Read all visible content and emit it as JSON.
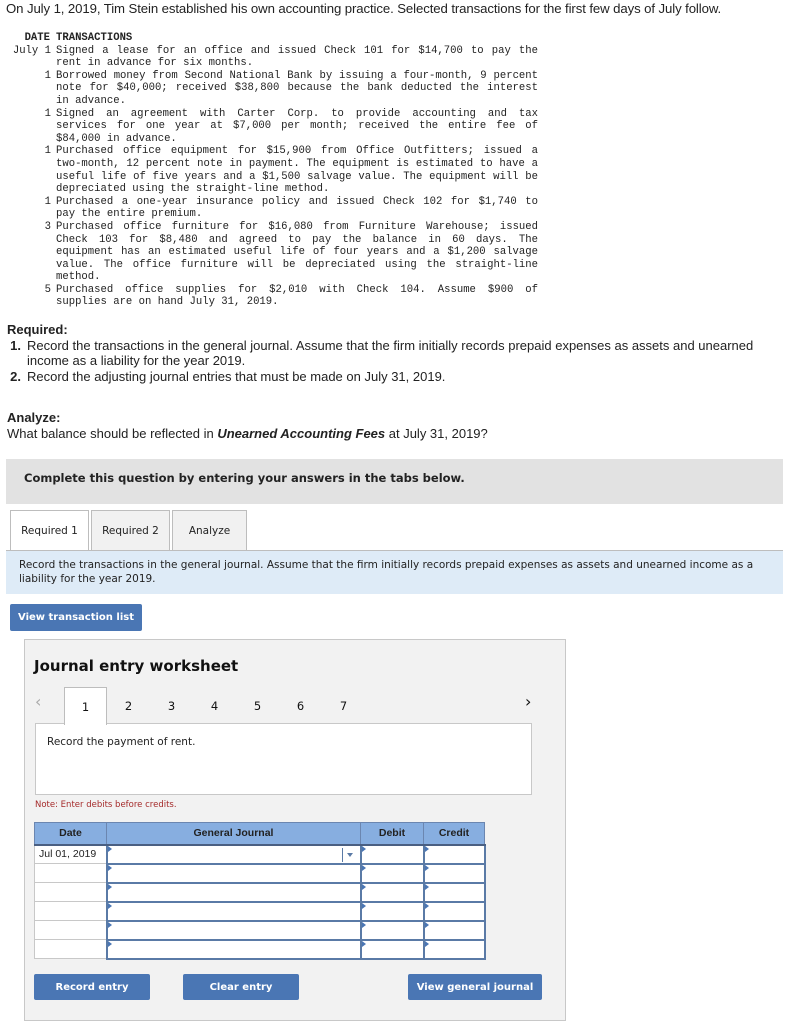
{
  "intro": "On July 1, 2019, Tim Stein established his own accounting practice. Selected transactions for the first few days of July follow.",
  "transactions": {
    "headers": {
      "date": "DATE",
      "transactions": "TRANSACTIONS"
    },
    "rows": [
      {
        "date": "July 1",
        "text": "Signed a lease for an office and issued Check 101 for $14,700 to pay the rent in advance for six months."
      },
      {
        "date": "1",
        "text": "Borrowed money from Second National Bank by issuing a four-month, 9 percent note for $40,000; received $38,800 because the bank deducted the interest in advance."
      },
      {
        "date": "1",
        "text": "Signed an agreement with Carter Corp. to provide accounting and tax services for one year at $7,000 per month; received the entire fee of $84,000 in advance."
      },
      {
        "date": "1",
        "text": "Purchased office equipment for $15,900 from Office Outfitters; issued a two-month, 12 percent note in payment. The equipment is estimated to have a useful life of five years and a $1,500 salvage value. The equipment will be depreciated using the straight-line method."
      },
      {
        "date": "1",
        "text": "Purchased a one-year insurance policy and issued Check 102 for $1,740 to pay the entire premium."
      },
      {
        "date": "3",
        "text": "Purchased office furniture for $16,080 from Furniture Warehouse; issued Check 103 for $8,480 and agreed to pay the balance in 60 days. The equipment has an estimated useful life of four years and a $1,200 salvage value. The office furniture will be depreciated using the straight-line method."
      },
      {
        "date": "5",
        "text": "Purchased office supplies for $2,010 with Check 104. Assume $900 of supplies are on hand July 31, 2019."
      }
    ]
  },
  "required": {
    "heading": "Required:",
    "items": [
      {
        "num": "1.",
        "text": "Record the transactions in the general journal. Assume that the firm initially records prepaid expenses as assets and unearned income as a liability for the year 2019."
      },
      {
        "num": "2.",
        "text": "Record the adjusting journal entries that must be made on July 31, 2019."
      }
    ]
  },
  "analyze": {
    "heading": "Analyze:",
    "question_before": "What balance should be reflected in ",
    "question_emphasis": "Unearned Accounting Fees",
    "question_after": " at July 31, 2019?"
  },
  "instructions_bar": "Complete this question by entering your answers in the tabs below.",
  "tabs": [
    {
      "label": "Required 1",
      "active": true
    },
    {
      "label": "Required 2",
      "active": false
    },
    {
      "label": "Analyze",
      "active": false
    }
  ],
  "tab_description": "Record the transactions in the general journal. Assume that the firm initially records prepaid expenses as assets and unearned income as a liability for the year 2019.",
  "view_transaction_list_label": "View transaction list",
  "worksheet": {
    "title": "Journal entry worksheet",
    "prev_icon": "chevron-left-icon",
    "next_icon": "chevron-right-icon",
    "pages": [
      "1",
      "2",
      "3",
      "4",
      "5",
      "6",
      "7"
    ],
    "active_page": "1",
    "prompt": "Record the payment of rent.",
    "note": "Note: Enter debits before credits.",
    "table": {
      "headers": {
        "date": "Date",
        "journal": "General Journal",
        "debit": "Debit",
        "credit": "Credit"
      },
      "rows": [
        {
          "date": "Jul 01, 2019",
          "account": "",
          "debit": "",
          "credit": ""
        },
        {
          "date": "",
          "account": "",
          "debit": "",
          "credit": ""
        },
        {
          "date": "",
          "account": "",
          "debit": "",
          "credit": ""
        },
        {
          "date": "",
          "account": "",
          "debit": "",
          "credit": ""
        },
        {
          "date": "",
          "account": "",
          "debit": "",
          "credit": ""
        },
        {
          "date": "",
          "account": "",
          "debit": "",
          "credit": ""
        }
      ]
    },
    "buttons": {
      "record": "Record entry",
      "clear": "Clear entry",
      "view_journal": "View general journal"
    }
  },
  "colors": {
    "button_blue": "#4a76b4",
    "table_header_blue": "#87aee0",
    "tab_desc_bg": "#deebf7",
    "note_red": "#a52a2a"
  }
}
